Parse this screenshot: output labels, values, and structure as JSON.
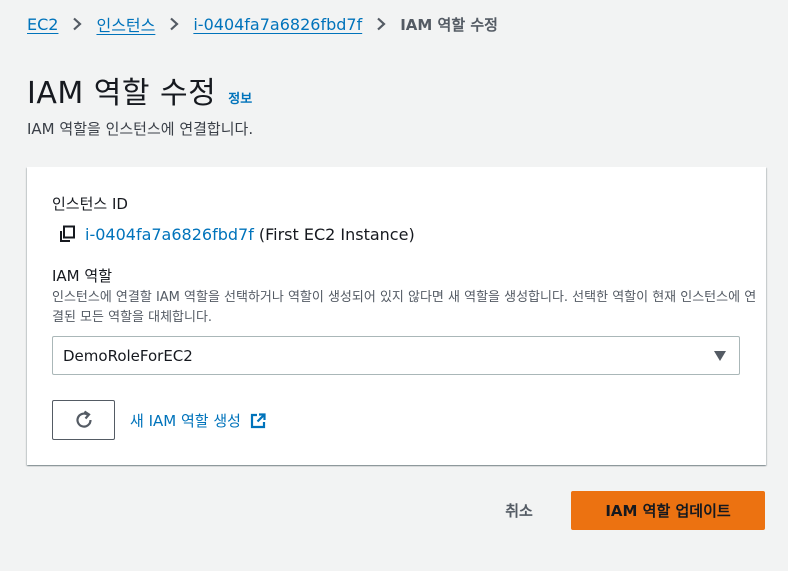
{
  "breadcrumb": {
    "items": [
      "EC2",
      "인스턴스",
      "i-0404fa7a6826fbd7f"
    ],
    "current": "IAM 역할 수정"
  },
  "header": {
    "title": "IAM 역할 수정",
    "info_link": "정보",
    "description": "IAM 역할을 인스턴스에 연결합니다."
  },
  "instance": {
    "label": "인스턴스 ID",
    "id": "i-0404fa7a6826fbd7f",
    "name": "(First EC2 Instance)"
  },
  "iam_role": {
    "label": "IAM 역할",
    "description": "인스턴스에 연결할 IAM 역할을 선택하거나 역할이 생성되어 있지 않다면 새 역할을 생성합니다. 선택한 역할이 현재 인스턴스에 연결된 모든 역할을 대체합니다.",
    "selected": "DemoRoleForEC2",
    "create_link": "새 IAM 역할 생성"
  },
  "actions": {
    "cancel_label": "취소",
    "submit_label": "IAM 역할 업데이트"
  },
  "icons": {
    "breadcrumb_separator": "chevron-right-icon",
    "copy": "copy-icon",
    "refresh": "refresh-icon",
    "external": "external-link-icon",
    "dropdown": "caret-down-icon"
  },
  "colors": {
    "link": "#0073bb",
    "primary_button": "#ec7211",
    "background": "#f2f3f3",
    "text": "#16191f",
    "secondary_text": "#545b64"
  }
}
